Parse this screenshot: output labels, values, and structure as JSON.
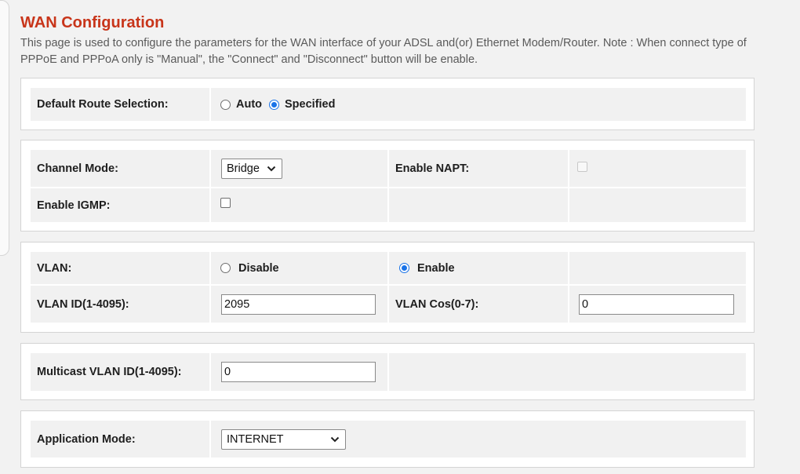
{
  "page": {
    "title": "WAN Configuration",
    "description": "This page is used to configure the parameters for the WAN interface of your ADSL and(or) Ethernet Modem/Router. Note : When connect type of PPPoE and PPPoA only is \"Manual\", the \"Connect\" and \"Disconnect\" button will be enable."
  },
  "default_route": {
    "label": "Default Route Selection:",
    "options": [
      {
        "label": "Auto",
        "selected": false
      },
      {
        "label": "Specified",
        "selected": true
      }
    ]
  },
  "channel": {
    "mode_label": "Channel Mode:",
    "mode_value": "Bridge",
    "napt_label": "Enable NAPT:",
    "napt_checked": false,
    "napt_disabled": true,
    "igmp_label": "Enable IGMP:",
    "igmp_checked": false
  },
  "vlan": {
    "label": "VLAN:",
    "options": [
      {
        "label": "Disable",
        "selected": false
      },
      {
        "label": "Enable",
        "selected": true
      }
    ],
    "id_label": "VLAN ID(1-4095):",
    "id_value": "2095",
    "cos_label": "VLAN Cos(0-7):",
    "cos_value": "0"
  },
  "multicast": {
    "label": "Multicast VLAN ID(1-4095):",
    "value": "0"
  },
  "application": {
    "label": "Application Mode:",
    "value": "INTERNET"
  },
  "colors": {
    "title": "#c8351a",
    "radio_selected": "#1a73e8",
    "cell_bg": "#f1f1f1",
    "page_bg": "#f2f2f2"
  },
  "icons": {
    "select_arrow": "chevron-down-icon"
  }
}
